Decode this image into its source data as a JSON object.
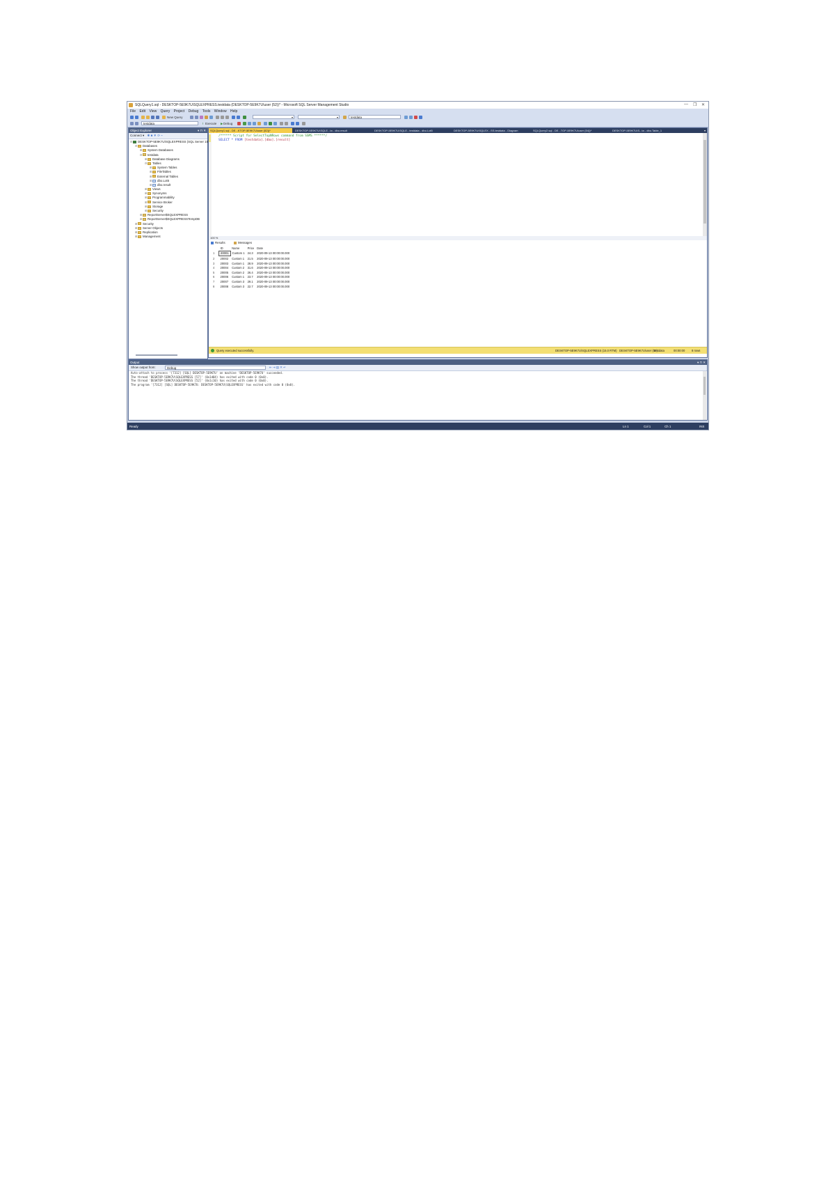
{
  "window": {
    "title": "SQLQuery1.sql - DESKTOP-5E9K7U\\SQLEXPRESS.testdata (DESKTOP-5E9K7U\\user (52))* - Microsoft SQL Server Management Studio",
    "controls": [
      "—",
      "❐",
      "✕"
    ]
  },
  "menu": [
    "File",
    "Edit",
    "View",
    "Query",
    "Project",
    "Debug",
    "Tools",
    "Window",
    "Help"
  ],
  "toolbar": {
    "new_query": "New Query",
    "db_combo": "testdata",
    "search_combo": "testdata",
    "execute": "Execute",
    "debug": "Debug"
  },
  "object_explorer": {
    "header": "Object Explorer",
    "connect": "Connect ▾",
    "nodes": [
      {
        "label": "DESKTOP-5E9K7U\\SQLEXPRESS (SQL Server 15.0.2000 - DESKTOP-5E9K7U\\user)",
        "level": 0,
        "kind": "server",
        "exp": "⊟"
      },
      {
        "label": "Databases",
        "level": 1,
        "kind": "folder",
        "exp": "⊟"
      },
      {
        "label": "System Databases",
        "level": 2,
        "kind": "folder",
        "exp": "⊞"
      },
      {
        "label": "testdata",
        "level": 2,
        "kind": "db",
        "exp": "⊟"
      },
      {
        "label": "Database Diagrams",
        "level": 3,
        "kind": "folder",
        "exp": "⊞"
      },
      {
        "label": "Tables",
        "level": 3,
        "kind": "folder",
        "exp": "⊟"
      },
      {
        "label": "System Tables",
        "level": 4,
        "kind": "folder",
        "exp": "⊞"
      },
      {
        "label": "FileTables",
        "level": 4,
        "kind": "folder",
        "exp": "⊞"
      },
      {
        "label": "External Tables",
        "level": 4,
        "kind": "folder",
        "exp": "⊞"
      },
      {
        "label": "dbo.Lot5",
        "level": 4,
        "kind": "table",
        "exp": "⊞"
      },
      {
        "label": "dbo.result",
        "level": 4,
        "kind": "table",
        "exp": "⊞"
      },
      {
        "label": "Views",
        "level": 3,
        "kind": "folder",
        "exp": "⊞"
      },
      {
        "label": "Synonyms",
        "level": 3,
        "kind": "folder",
        "exp": "⊞"
      },
      {
        "label": "Programmability",
        "level": 3,
        "kind": "folder",
        "exp": "⊞"
      },
      {
        "label": "Service Broker",
        "level": 3,
        "kind": "folder",
        "exp": "⊞"
      },
      {
        "label": "Storage",
        "level": 3,
        "kind": "folder",
        "exp": "⊞"
      },
      {
        "label": "Security",
        "level": 3,
        "kind": "folder",
        "exp": "⊞"
      },
      {
        "label": "ReportServer$SQLEXPRESS",
        "level": 2,
        "kind": "db",
        "exp": "⊞"
      },
      {
        "label": "ReportServer$SQLEXPRESSTempDB",
        "level": 2,
        "kind": "db",
        "exp": "⊞"
      },
      {
        "label": "Security",
        "level": 1,
        "kind": "folder",
        "exp": "⊞"
      },
      {
        "label": "Server Objects",
        "level": 1,
        "kind": "folder",
        "exp": "⊞"
      },
      {
        "label": "Replication",
        "level": 1,
        "kind": "folder",
        "exp": "⊞"
      },
      {
        "label": "Management",
        "level": 1,
        "kind": "folder",
        "exp": "⊞"
      }
    ]
  },
  "tabs": [
    {
      "label": "SQLQuery1.sql - DE...KTOP-5E9K7U\\user (52))*",
      "active": true
    },
    {
      "label": "DESKTOP-5E9K7U\\SQLE...ta - dbo.result",
      "active": false
    },
    {
      "label": "DESKTOP-5E9K7U\\SQLE...testdata - dbo.Lot5",
      "active": false
    },
    {
      "label": "DESKTOP-5E9K7U\\SQLEX...SS.testdata - Diagram",
      "active": false
    },
    {
      "label": "SQLQuery2.sql - DE...TOP-5E9K7U\\user (54))*",
      "active": false
    },
    {
      "label": "DESKTOP-5E9K7U\\S...ta - dbo.Table_1",
      "active": false
    }
  ],
  "editor": {
    "comment": "/****** Script for SelectTopNRows command from SSMS  ******/",
    "kw_select": "SELECT",
    "star_from": " * FROM ",
    "object": "[testdata].[dbo].[result]",
    "zoom": "100 %"
  },
  "results": {
    "tab_results": "Results",
    "tab_messages": "Messages",
    "columns": [
      "ID",
      "Name",
      "Price",
      "Date"
    ],
    "rows": [
      [
        "1",
        "20001",
        "Custom 1",
        "24.3",
        "2020-09-13 00:00:00.000"
      ],
      [
        "2",
        "20002",
        "Custom 1",
        "21.5",
        "2020-09-13 00:00:00.000"
      ],
      [
        "3",
        "20003",
        "Custom 1",
        "28.9",
        "2020-09-13 00:00:00.000"
      ],
      [
        "4",
        "20004",
        "Custom 2",
        "31.6",
        "2020-09-13 00:00:00.000"
      ],
      [
        "5",
        "20005",
        "Custom 2",
        "26.4",
        "2020-09-13 00:00:00.000"
      ],
      [
        "6",
        "20006",
        "Custom 1",
        "23.7",
        "2020-09-13 00:00:00.000"
      ],
      [
        "7",
        "20007",
        "Custom 3",
        "29.1",
        "2020-09-13 00:00:00.000"
      ],
      [
        "8",
        "20008",
        "Custom 3",
        "22.7",
        "2020-09-13 00:00:00.000"
      ]
    ]
  },
  "status": {
    "message": "Query executed successfully.",
    "server": "DESKTOP-5E9K7U\\SQLEXPRESS (15.0 RTM)",
    "user": "DESKTOP-5E9K7U\\user (52)",
    "db": "testdata",
    "time": "00:00:00",
    "rows": "8 rows"
  },
  "output": {
    "header": "Output",
    "show_from_label": "Show output from:",
    "show_from_value": "Debug",
    "lines": [
      "Auto-attach to process '[7312] [SQL] DESKTOP-5E9K7U' on machine 'DESKTOP-5E9K7U' succeeded.",
      "The thread 'DESKTOP-5E9K7U\\SQLEXPRESS [57]' (0x1d04) has exited with code 0 (0x0).",
      "The thread 'DESKTOP-5E9K7U\\SQLEXPRESS [52]' (0x1c10) has exited with code 0 (0x0).",
      "The program '[7312] [SQL] DESKTOP-5E9K7U: DESKTOP-5E9K7U\\SQLEXPRESS' has exited with code 0 (0x0)."
    ]
  },
  "appstatus": {
    "ready": "Ready",
    "ln": "Ln 1",
    "col": "Col 1",
    "ch": "Ch 1",
    "ins": "INS"
  },
  "colors": {
    "accent_tab": "#f5cc49",
    "chrome": "#2d3e60",
    "status": "#f3df74"
  }
}
